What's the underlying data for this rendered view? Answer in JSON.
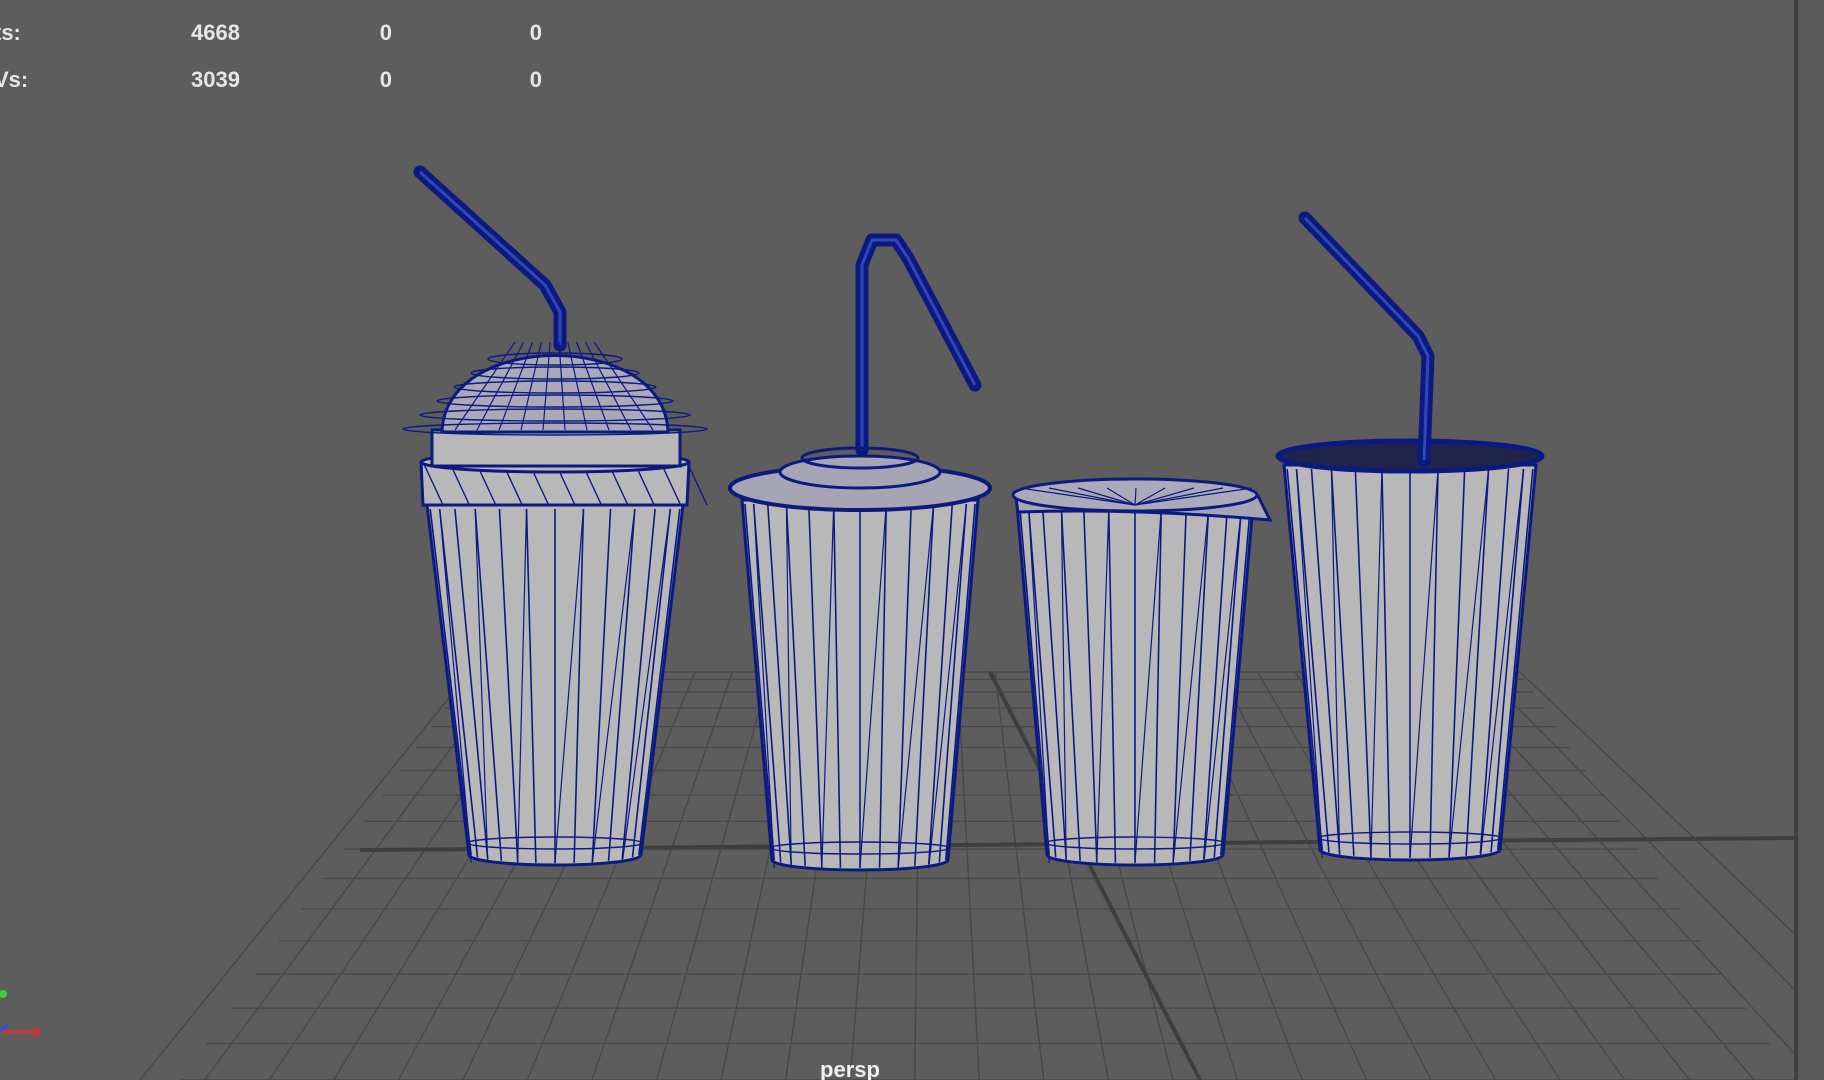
{
  "hud": {
    "rows": [
      {
        "label": "ts:",
        "values": [
          "4668",
          "0",
          "0"
        ]
      },
      {
        "label": "Vs:",
        "values": [
          "3039",
          "0",
          "0"
        ]
      }
    ]
  },
  "viewport": {
    "camera": "persp",
    "background_color": "#5d5d5d",
    "grid_color": "#484848",
    "wire_color": "#0c1a80",
    "surface_color": "#b8b8b8"
  },
  "scene": {
    "objects": [
      {
        "name": "dome-lid cup with straw"
      },
      {
        "name": "flat-lid cup with bent straw"
      },
      {
        "name": "sip-lid cup"
      },
      {
        "name": "open cup with straw"
      }
    ]
  },
  "gizmo": {
    "icons": [
      "y-axis-icon",
      "x-axis-icon",
      "z-axis-icon"
    ]
  }
}
